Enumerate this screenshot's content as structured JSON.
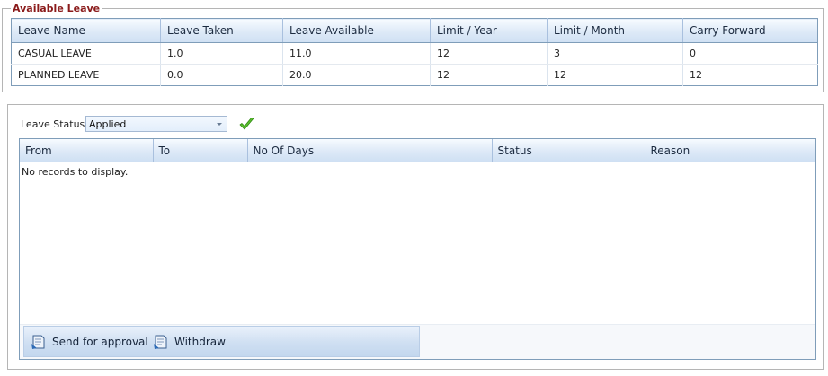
{
  "available_leave": {
    "legend": "Available Leave",
    "columns": [
      "Leave Name",
      "Leave Taken",
      "Leave Available",
      "Limit / Year",
      "Limit / Month",
      "Carry Forward"
    ],
    "rows": [
      [
        "CASUAL LEAVE",
        "1.0",
        "11.0",
        "12",
        "3",
        "0"
      ],
      [
        "PLANNED LEAVE",
        "0.0",
        "20.0",
        "12",
        "12",
        "12"
      ]
    ]
  },
  "filter": {
    "label": "Leave Status",
    "selected": "Applied"
  },
  "requests_grid": {
    "columns": [
      "From",
      "To",
      "No Of Days",
      "Status",
      "Reason"
    ],
    "empty_text": "No records to display."
  },
  "toolbar": {
    "send_label": "Send for approval",
    "withdraw_label": "Withdraw"
  },
  "icons": {
    "apply": "checkmark-icon",
    "send": "document-send-icon",
    "withdraw": "document-withdraw-icon"
  },
  "colors": {
    "legend": "#8a1a1a",
    "grid_border": "#7f9db9",
    "check": "#3fa21c"
  }
}
